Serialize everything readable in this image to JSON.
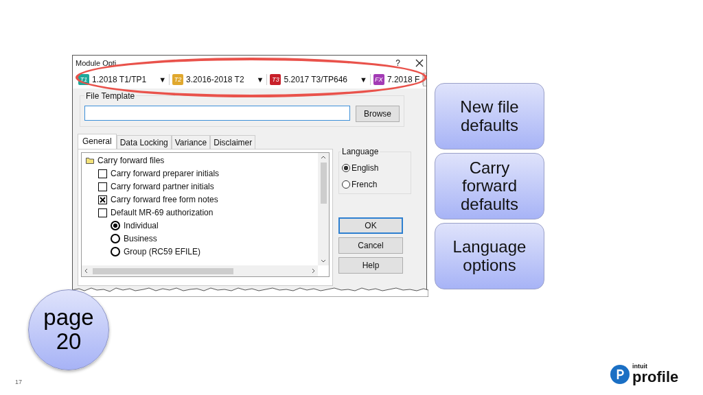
{
  "dialog": {
    "title": "Module Opti",
    "help": "?",
    "modules": [
      {
        "badge": "T1",
        "label": "1.2018 T1/TP1",
        "color": "#1fa89a",
        "arrow": "▼"
      },
      {
        "badge": "T2",
        "label": "3.2016-2018 T2",
        "color": "#e0a82e",
        "arrow": "▼"
      },
      {
        "badge": "T3",
        "label": "5.2017 T3/TP646",
        "color": "#c8202a",
        "arrow": "▼"
      },
      {
        "badge": "FX",
        "label": "7.2018 F",
        "color": "#a33bb5"
      }
    ],
    "file_template": {
      "label": "File Template",
      "button": "Browse"
    },
    "tabs": [
      {
        "label": "General",
        "selected": true
      },
      {
        "label": "Data Locking",
        "selected": false
      },
      {
        "label": "Variance",
        "selected": false
      },
      {
        "label": "Disclaimer",
        "selected": false
      }
    ],
    "tree": [
      {
        "kind": "folder",
        "label": "Carry forward files",
        "children": [
          {
            "kind": "checkbox",
            "label": "Carry forward preparer initials",
            "checked": false
          },
          {
            "kind": "checkbox",
            "label": "Carry forward partner initials",
            "checked": false
          },
          {
            "kind": "checkbox",
            "label": "Carry forward free form notes",
            "checked": true
          },
          {
            "kind": "checkbox",
            "label": "Default MR-69 authorization",
            "checked": false,
            "children": [
              {
                "kind": "radio",
                "label": "Individual",
                "selected": true
              },
              {
                "kind": "radio",
                "label": "Business",
                "selected": false
              },
              {
                "kind": "radio",
                "label": "Group (RC59 EFILE)",
                "selected": false
              }
            ]
          }
        ]
      }
    ],
    "language": {
      "label": "Language",
      "options": [
        {
          "label": "English",
          "selected": true
        },
        {
          "label": "French",
          "selected": false
        }
      ]
    },
    "buttons": [
      {
        "label": "OK",
        "default": true
      },
      {
        "label": "Cancel",
        "default": false
      },
      {
        "label": "Help",
        "default": false
      }
    ]
  },
  "callouts": [
    "New file defaults",
    "Carry forward defaults",
    "Language options"
  ],
  "page_badge": "page 20",
  "page_number": "17",
  "logo": {
    "small": "intuit",
    "main": "profile"
  }
}
